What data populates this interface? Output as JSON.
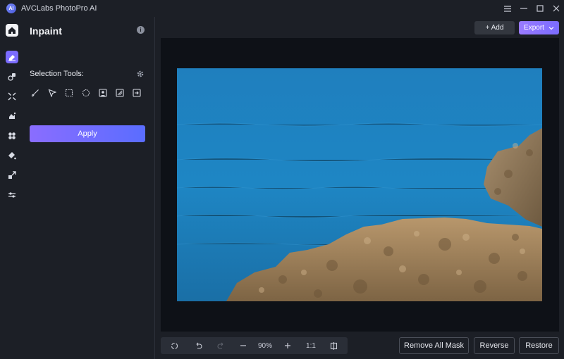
{
  "app": {
    "title": "AVCLabs PhotoPro AI",
    "logo_text": "AI"
  },
  "window_controls": [
    "menu-icon",
    "minimize-icon",
    "maximize-icon",
    "close-icon"
  ],
  "rail": [
    "home-icon",
    "inpaint-icon",
    "retouch-icon",
    "expand-icon",
    "replace-sky-icon",
    "remove-object-icon",
    "colorize-icon",
    "upscale-icon",
    "adjust-icon"
  ],
  "panel": {
    "title": "Inpaint",
    "selection_label": "Selection Tools:",
    "tools": [
      "brush-icon",
      "polygon-lasso-icon",
      "rectangle-select-icon",
      "ellipse-select-icon",
      "portrait-select-icon",
      "ai-select-icon",
      "import-mask-icon"
    ],
    "apply_label": "Apply"
  },
  "top_actions": {
    "add_label": "+ Add",
    "export_label": "Export"
  },
  "zoombar": {
    "zoom": "90%",
    "ratio": "1:1"
  },
  "bottom_actions": {
    "remove_all_mask": "Remove All Mask",
    "reverse": "Reverse",
    "restore": "Restore"
  },
  "colors": {
    "accent": "#7b6cff",
    "background": "#1c1f26",
    "canvas": "#0e1117",
    "sea": "#1e86c4",
    "rock": "#a5865e"
  }
}
